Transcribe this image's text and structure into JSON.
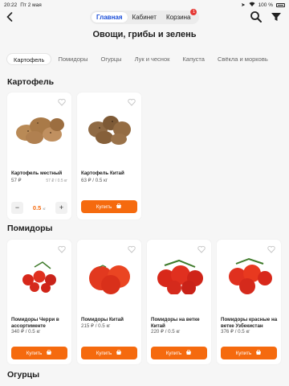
{
  "status": {
    "time": "20:22",
    "date": "Пт 2 мая",
    "battery": "100 %"
  },
  "nav": {
    "tabs": [
      {
        "label": "Главная",
        "active": true
      },
      {
        "label": "Кабинет",
        "active": false
      },
      {
        "label": "Корзина",
        "active": false,
        "badge": "1"
      }
    ]
  },
  "page": {
    "title": "Овощи, грибы и зелень"
  },
  "categories": [
    "Картофель",
    "Помидоры",
    "Огурцы",
    "Лук и чеснок",
    "Капуста",
    "Свёкла и морковь"
  ],
  "sections": {
    "potatoes": {
      "title": "Картофель",
      "products": [
        {
          "name": "Картофель местный",
          "price": "57 ₽",
          "unit_price": "57 ₽ / 0.5 кг",
          "qty": "0.5",
          "qty_unit": "кг"
        },
        {
          "name": "Картофель Китай",
          "price": "63 ₽ / 0.5 кг",
          "button": "Купить"
        }
      ]
    },
    "tomatoes": {
      "title": "Помидоры",
      "products": [
        {
          "name": "Помидоры Черри в ассортименте",
          "price": "340 ₽ / 0.5 кг",
          "button": "Купить"
        },
        {
          "name": "Помидоры Китай",
          "price": "215 ₽ / 0.5 кг",
          "button": "Купить"
        },
        {
          "name": "Помидоры на ветке Китай",
          "price": "220 ₽ / 0.5 кг",
          "button": "Купить"
        },
        {
          "name": "Помидоры красные на ветке Узбекистан",
          "price": "376 ₽ / 0.5 кг",
          "button": "Купить"
        }
      ]
    },
    "cucumbers": {
      "title": "Огурцы"
    }
  },
  "colors": {
    "accent": "#f56a0e",
    "active_tab": "#1c4fd8",
    "badge": "#e53935"
  }
}
